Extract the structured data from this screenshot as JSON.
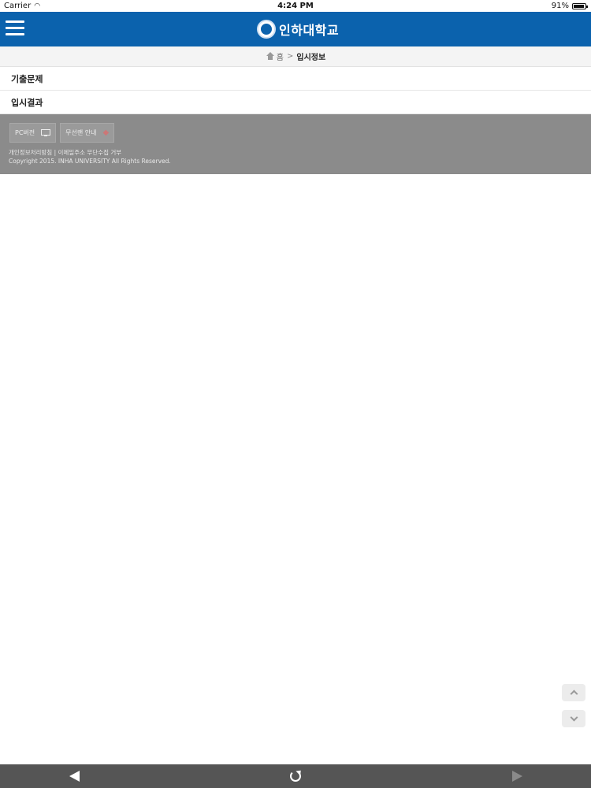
{
  "status_bar": {
    "carrier": "Carrier",
    "time": "4:24 PM",
    "battery_percent": "91%",
    "battery_level": 0.91
  },
  "header": {
    "logo_text": "인하대학교",
    "menu_icon": "hamburger-icon",
    "brand_color": "#0b62ad"
  },
  "breadcrumb": {
    "home": "홈",
    "separator": ">",
    "current": "입시정보"
  },
  "list": {
    "items": [
      {
        "label": "기출문제"
      },
      {
        "label": "입시결과"
      }
    ]
  },
  "footer": {
    "pc_version_label": "PC버전",
    "wireless_label": "무선랜 안내",
    "policy_links": "개인정보처리방침 | 이메일주소 무단수집 거부",
    "copyright": "Copyright 2015. INHA UNIVERSITY All Rights Reserved."
  },
  "toolbar": {
    "back_icon": "back-arrow-icon",
    "reload_icon": "reload-icon",
    "forward_icon": "forward-arrow-icon"
  }
}
